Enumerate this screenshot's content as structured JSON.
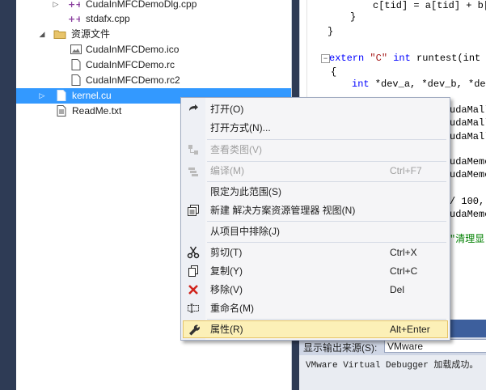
{
  "explorer": {
    "items": [
      {
        "label": "CudaInMFCDemoDlg.cpp",
        "icon": "cpp-file-icon",
        "arrow": "▷"
      },
      {
        "label": "stdafx.cpp",
        "icon": "cpp-file-icon",
        "arrow": ""
      },
      {
        "label": "资源文件",
        "icon": "folder-icon",
        "arrow": "◢"
      },
      {
        "label": "CudaInMFCDemo.ico",
        "icon": "image-file-icon",
        "arrow": ""
      },
      {
        "label": "CudaInMFCDemo.rc",
        "icon": "rc-file-icon",
        "arrow": ""
      },
      {
        "label": "CudaInMFCDemo.rc2",
        "icon": "rc-file-icon",
        "arrow": ""
      },
      {
        "label": "kernel.cu",
        "icon": "cu-file-icon",
        "arrow": "▷"
      },
      {
        "label": "ReadMe.txt",
        "icon": "text-file-icon",
        "arrow": ""
      }
    ]
  },
  "editor": {
    "lines": [
      {
        "text": "c[tid] = a[tid] + b["
      },
      {
        "text": "}"
      },
      {
        "text": "}"
      },
      {
        "kw": "extern",
        "str": "\"C\"",
        "kw2": "int",
        "rest": " runtest(int *"
      },
      {
        "text": "{"
      },
      {
        "kw": "int",
        "rest": " *dev_a, *dev_b, *dev"
      },
      {
        "text": "udaMall"
      },
      {
        "text": "udaMall"
      },
      {
        "text": "udaMall"
      },
      {
        "text": "udaMemc"
      },
      {
        "text": "udaMemc"
      },
      {
        "text": "/ 100,"
      },
      {
        "text": "udaMemc"
      },
      {
        "cmt": "\"清理显"
      }
    ]
  },
  "output": {
    "source_label": "显示输出来源(S):",
    "source_value": "VMware",
    "text": "VMware Virtual Debugger 加载成功。"
  },
  "context_menu": {
    "items": [
      {
        "label": "打开(O)",
        "shortcut": "",
        "icon": "open-icon",
        "disabled": false
      },
      {
        "label": "打开方式(N)...",
        "shortcut": "",
        "icon": "",
        "disabled": false
      },
      {
        "label": "查看类图(V)",
        "shortcut": "",
        "icon": "class-diagram-icon",
        "disabled": true
      },
      {
        "label": "编译(M)",
        "shortcut": "Ctrl+F7",
        "icon": "compile-icon",
        "disabled": true
      },
      {
        "label": "限定为此范围(S)",
        "shortcut": "",
        "icon": "",
        "disabled": false
      },
      {
        "label": "新建 解决方案资源管理器 视图(N)",
        "shortcut": "",
        "icon": "new-view-icon",
        "disabled": false
      },
      {
        "label": "从项目中排除(J)",
        "shortcut": "",
        "icon": "",
        "disabled": false
      },
      {
        "label": "剪切(T)",
        "shortcut": "Ctrl+X",
        "icon": "cut-icon",
        "disabled": false
      },
      {
        "label": "复制(Y)",
        "shortcut": "Ctrl+C",
        "icon": "copy-icon",
        "disabled": false
      },
      {
        "label": "移除(V)",
        "shortcut": "Del",
        "icon": "remove-icon",
        "disabled": false
      },
      {
        "label": "重命名(M)",
        "shortcut": "",
        "icon": "rename-icon",
        "disabled": false
      },
      {
        "label": "属性(R)",
        "shortcut": "Alt+Enter",
        "icon": "wrench-icon",
        "disabled": false
      }
    ]
  },
  "colors": {
    "selection": "#3399ff",
    "menu_highlight": "#fcf0b7",
    "keyword": "#0000ff",
    "string": "#a31515",
    "comment": "#008000"
  }
}
